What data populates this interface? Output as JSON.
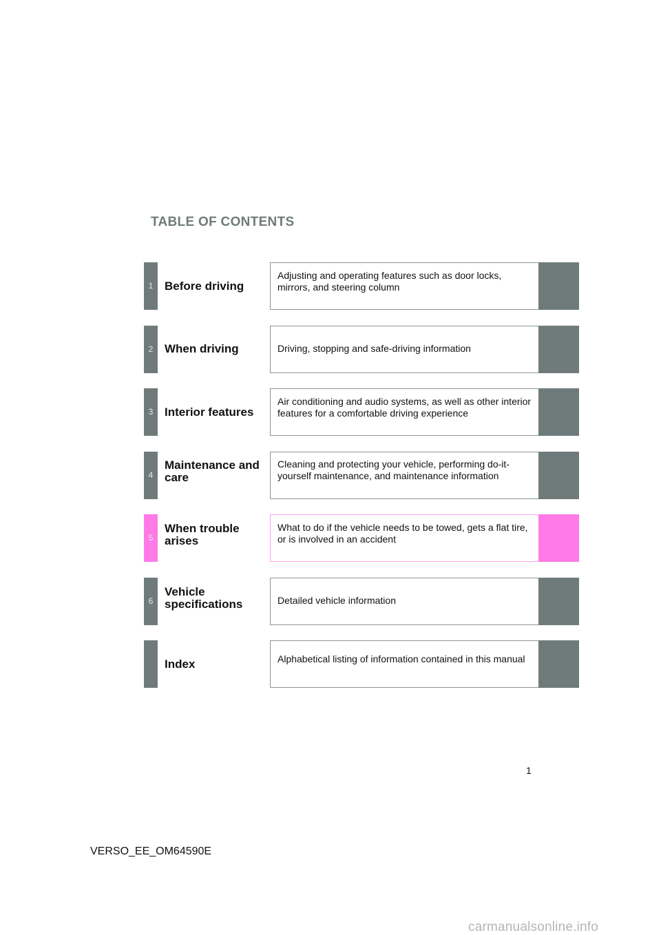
{
  "header": {
    "title": "TABLE OF CONTENTS"
  },
  "chapters": [
    {
      "number": "1",
      "title": "Before driving",
      "description": "Adjusting and operating features such as door locks, mirrors, and steering column",
      "active": false
    },
    {
      "number": "2",
      "title": "When driving",
      "description": "Driving, stopping and safe-driving information",
      "active": false
    },
    {
      "number": "3",
      "title": "Interior features",
      "description": "Air conditioning and audio systems, as well as other interior features for a comfortable driving experience",
      "active": false
    },
    {
      "number": "4",
      "title": "Maintenance and care",
      "description": "Cleaning and protecting your vehicle, performing do-it-yourself maintenance, and maintenance information",
      "active": false
    },
    {
      "number": "5",
      "title": "When trouble arises",
      "description": "What to do if the vehicle needs to be towed, gets a flat tire, or is involved in an accident",
      "active": true
    },
    {
      "number": "6",
      "title": "Vehicle specifications",
      "description": "Detailed vehicle information",
      "active": false
    },
    {
      "number": "",
      "title": "Index",
      "description": "Alphabetical listing of information contained in this manual",
      "active": false
    }
  ],
  "colors": {
    "tab_gray": "#6f7b7a",
    "tab_active_pink": "#ff7ae6"
  },
  "footer": {
    "page_number": "1",
    "document_code": "VERSO_EE_OM64590E",
    "watermark": "carmanualsonline.info"
  }
}
